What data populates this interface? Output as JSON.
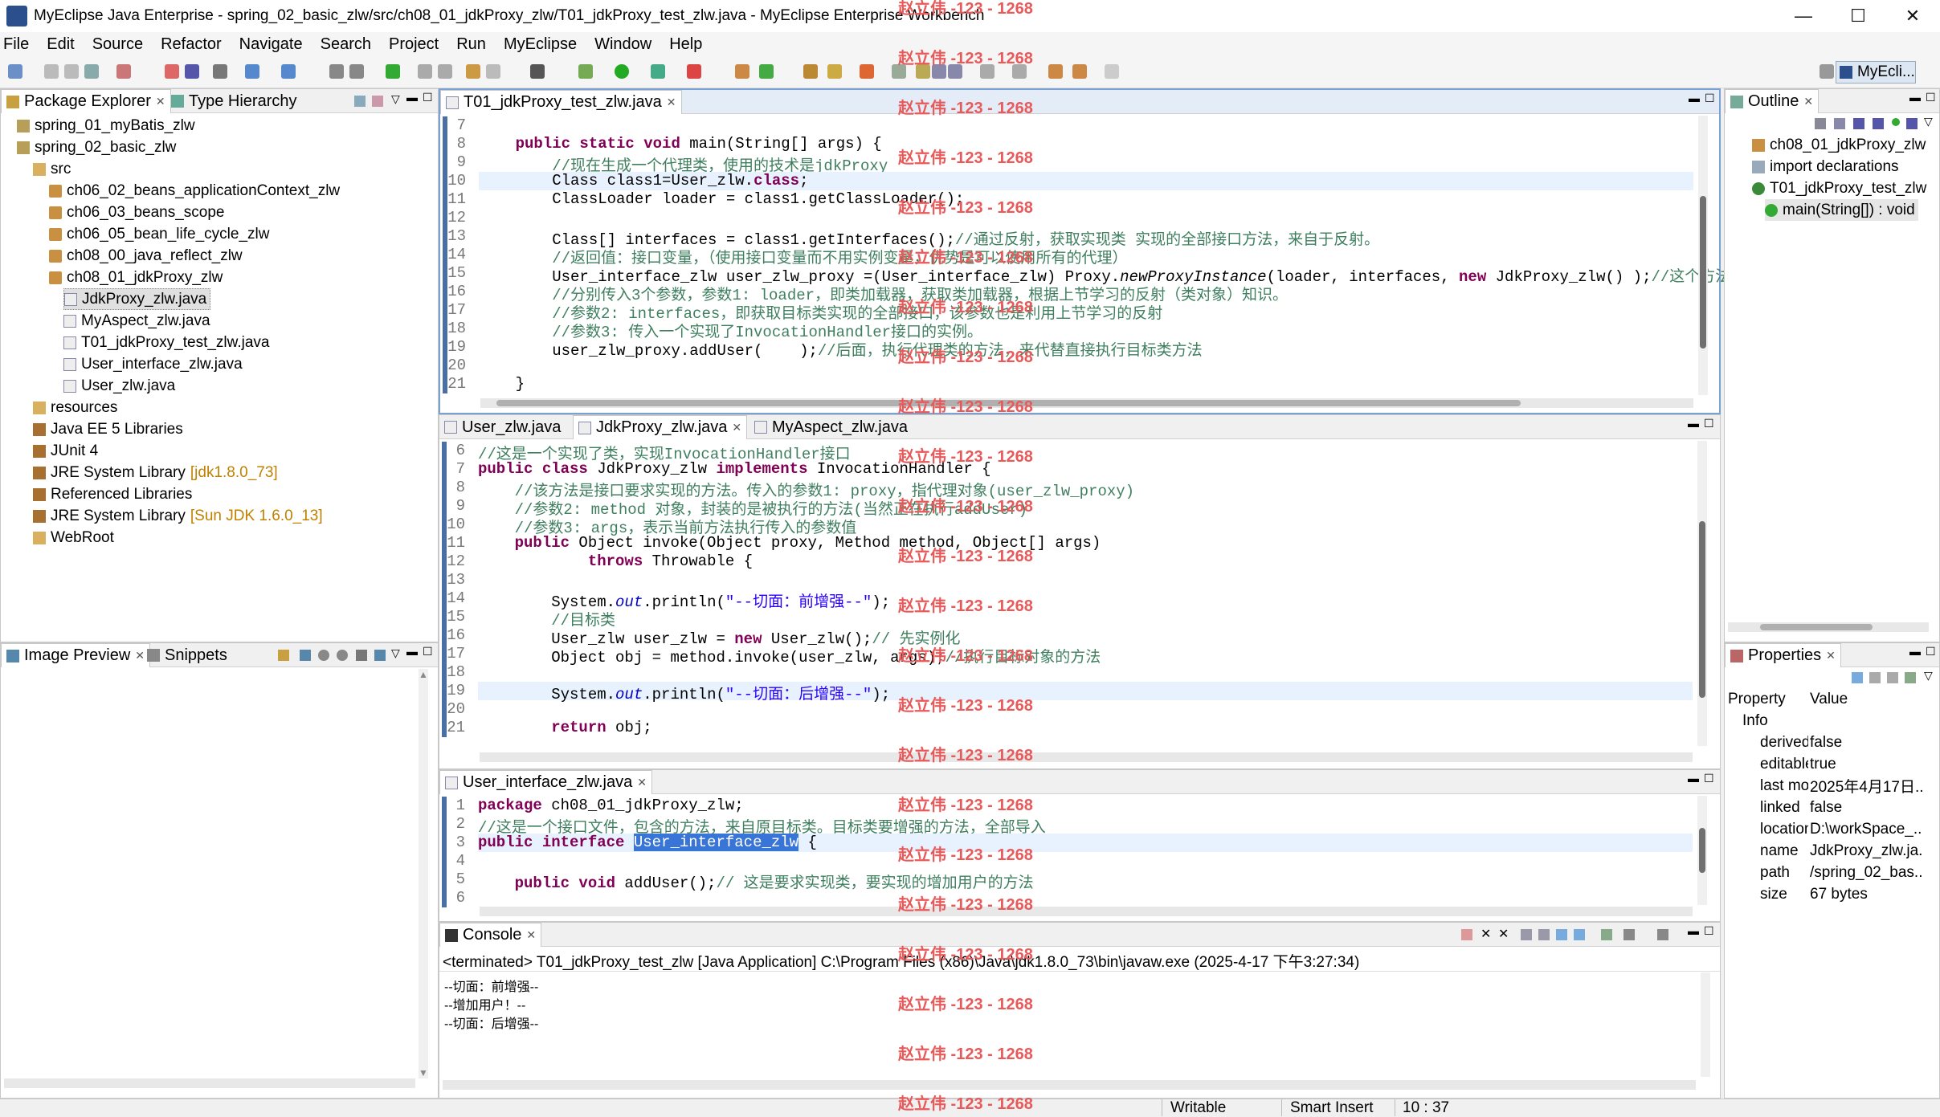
{
  "window": {
    "title": "MyEclipse Java Enterprise - spring_02_basic_zlw/src/ch08_01_jdkProxy_zlw/T01_jdkProxy_test_zlw.java - MyEclipse Enterprise Workbench",
    "minimize": "—",
    "maximize": "☐",
    "close": "✕"
  },
  "menu": [
    "File",
    "Edit",
    "Source",
    "Refactor",
    "Navigate",
    "Search",
    "Project",
    "Run",
    "MyEclipse",
    "Window",
    "Help"
  ],
  "perspective": "MyEcli...",
  "watermark": "赵立伟 -123 - 1268",
  "package_explorer": {
    "tabs": [
      "Package Explorer",
      "Type Hierarchy"
    ],
    "items": [
      {
        "label": "spring_01_myBatis_zlw",
        "decor": ""
      },
      {
        "label": "spring_02_basic_zlw",
        "decor": ""
      },
      {
        "label": "src",
        "decor": ""
      },
      {
        "label": "ch06_02_beans_applicationContext_zlw",
        "decor": ""
      },
      {
        "label": "ch06_03_beans_scope",
        "decor": ""
      },
      {
        "label": "ch06_05_bean_life_cycle_zlw",
        "decor": ""
      },
      {
        "label": "ch08_00_java_reflect_zlw",
        "decor": ""
      },
      {
        "label": "ch08_01_jdkProxy_zlw",
        "decor": ""
      },
      {
        "label": "JdkProxy_zlw.java",
        "decor": ""
      },
      {
        "label": "MyAspect_zlw.java",
        "decor": ""
      },
      {
        "label": "T01_jdkProxy_test_zlw.java",
        "decor": ""
      },
      {
        "label": "User_interface_zlw.java",
        "decor": ""
      },
      {
        "label": "User_zlw.java",
        "decor": ""
      },
      {
        "label": "resources",
        "decor": ""
      },
      {
        "label": "Java EE 5 Libraries",
        "decor": ""
      },
      {
        "label": "JUnit 4",
        "decor": ""
      },
      {
        "label": "JRE System Library",
        "decor": "[jdk1.8.0_73]"
      },
      {
        "label": "Referenced Libraries",
        "decor": ""
      },
      {
        "label": "JRE System Library",
        "decor": "[Sun JDK 1.6.0_13]"
      },
      {
        "label": "WebRoot",
        "decor": ""
      }
    ]
  },
  "image_preview": {
    "tabs": [
      "Image Preview",
      "Snippets"
    ]
  },
  "editor1": {
    "tab": "T01_jdkProxy_test_zlw.java",
    "lines": [
      {
        "n": "7",
        "segs": [
          {
            "t": ""
          }
        ]
      },
      {
        "n": "8",
        "segs": [
          {
            "t": "    "
          },
          {
            "t": "public static",
            "c": "kw"
          },
          {
            "t": " void",
            "c": "kw"
          },
          {
            "t": " main(String[] args) {"
          }
        ]
      },
      {
        "n": "9",
        "segs": [
          {
            "t": "        "
          },
          {
            "t": "//现在生成一个代理类，使用的技术是jdkProxy",
            "c": "cm"
          }
        ]
      },
      {
        "n": "10",
        "segs": [
          {
            "t": "        Class class1=User_zlw."
          },
          {
            "t": "class",
            "c": "kw"
          },
          {
            "t": ";"
          }
        ],
        "hl": true
      },
      {
        "n": "11",
        "segs": [
          {
            "t": "        ClassLoader loader = class1.getClassLoader();"
          }
        ]
      },
      {
        "n": "12",
        "segs": [
          {
            "t": ""
          }
        ]
      },
      {
        "n": "13",
        "segs": [
          {
            "t": "        Class[] interfaces = class1.getInterfaces();"
          },
          {
            "t": "//通过反射，获取实现类 实现的全部接口方法，来自于反射。",
            "c": "cm"
          }
        ]
      },
      {
        "n": "14",
        "segs": [
          {
            "t": "        "
          },
          {
            "t": "//返回值：接口变量，（使用接口变量而不用实例变量，优势是可以使用所有的代理）",
            "c": "cm"
          }
        ]
      },
      {
        "n": "15",
        "segs": [
          {
            "t": "        User_interface_zlw user_zlw_proxy =(User_interface_zlw) Proxy."
          },
          {
            "t": "newProxyInstance",
            "c": "ita"
          },
          {
            "t": "(loader, interfaces, "
          },
          {
            "t": "new",
            "c": "kw"
          },
          {
            "t": " JdkProxy_zlw() );"
          },
          {
            "t": "//这个方法是",
            "c": "cm"
          }
        ]
      },
      {
        "n": "16",
        "segs": [
          {
            "t": "        "
          },
          {
            "t": "//分别传入3个参数，参数1: loader，即类加载器，获取类加载器，根据上节学习的反射（类对象）知识。",
            "c": "cm"
          }
        ]
      },
      {
        "n": "17",
        "segs": [
          {
            "t": "        "
          },
          {
            "t": "//参数2: interfaces，即获取目标类实现的全部接口，该参数也是利用上节学习的反射",
            "c": "cm"
          }
        ]
      },
      {
        "n": "18",
        "segs": [
          {
            "t": "        "
          },
          {
            "t": "//参数3: 传入一个实现了InvocationHandler接口的实例。",
            "c": "cm"
          }
        ]
      },
      {
        "n": "19",
        "segs": [
          {
            "t": "        user_zlw_proxy.addUser(    );"
          },
          {
            "t": "//后面，执行代理类的方法，来代替直接执行目标类方法",
            "c": "cm"
          }
        ]
      },
      {
        "n": "20",
        "segs": [
          {
            "t": ""
          }
        ]
      },
      {
        "n": "21",
        "segs": [
          {
            "t": "    }"
          }
        ]
      }
    ]
  },
  "editor2": {
    "tabs": [
      "User_zlw.java",
      "JdkProxy_zlw.java",
      "MyAspect_zlw.java"
    ],
    "lines": [
      {
        "n": "6",
        "segs": [
          {
            "t": "//这是一个实现了类，实现InvocationHandler接口",
            "c": "cm"
          }
        ]
      },
      {
        "n": "7",
        "segs": [
          {
            "t": "public class",
            "c": "kw"
          },
          {
            "t": " JdkProxy_zlw "
          },
          {
            "t": "implements",
            "c": "kw"
          },
          {
            "t": " InvocationHandler {"
          }
        ]
      },
      {
        "n": "8",
        "segs": [
          {
            "t": "    "
          },
          {
            "t": "//该方法是接口要求实现的方法。传入的参数1: proxy，指代理对象(user_zlw_proxy)",
            "c": "cm"
          }
        ]
      },
      {
        "n": "9",
        "segs": [
          {
            "t": "    "
          },
          {
            "t": "//参数2: method 对象，封装的是被执行的方法(当然正在执行addUser)",
            "c": "cm"
          }
        ]
      },
      {
        "n": "10",
        "segs": [
          {
            "t": "    "
          },
          {
            "t": "//参数3: args，表示当前方法执行传入的参数值",
            "c": "cm"
          }
        ]
      },
      {
        "n": "11",
        "segs": [
          {
            "t": "    "
          },
          {
            "t": "public",
            "c": "kw"
          },
          {
            "t": " Object invoke(Object proxy, Method method, Object[] args)"
          }
        ]
      },
      {
        "n": "12",
        "segs": [
          {
            "t": "            "
          },
          {
            "t": "throws",
            "c": "kw"
          },
          {
            "t": " Throwable {"
          }
        ]
      },
      {
        "n": "13",
        "segs": [
          {
            "t": ""
          }
        ]
      },
      {
        "n": "14",
        "segs": [
          {
            "t": "        System."
          },
          {
            "t": "out",
            "c": "fi"
          },
          {
            "t": ".println("
          },
          {
            "t": "\"--切面：前增强--\"",
            "c": "st"
          },
          {
            "t": ");"
          }
        ]
      },
      {
        "n": "15",
        "segs": [
          {
            "t": "        "
          },
          {
            "t": "//目标类",
            "c": "cm"
          }
        ]
      },
      {
        "n": "16",
        "segs": [
          {
            "t": "        User_zlw user_zlw = "
          },
          {
            "t": "new",
            "c": "kw"
          },
          {
            "t": " User_zlw();"
          },
          {
            "t": "// 先实例化",
            "c": "cm"
          }
        ]
      },
      {
        "n": "17",
        "segs": [
          {
            "t": "        Object obj = method.invoke(user_zlw, args);"
          },
          {
            "t": "//执行目标对象的方法",
            "c": "cm"
          }
        ]
      },
      {
        "n": "18",
        "segs": [
          {
            "t": ""
          }
        ]
      },
      {
        "n": "19",
        "segs": [
          {
            "t": "        System."
          },
          {
            "t": "out",
            "c": "fi"
          },
          {
            "t": ".println("
          },
          {
            "t": "\"--切面：后增强--\"",
            "c": "st"
          },
          {
            "t": ");"
          }
        ],
        "hl": true
      },
      {
        "n": "20",
        "segs": [
          {
            "t": ""
          }
        ]
      },
      {
        "n": "21",
        "segs": [
          {
            "t": "        "
          },
          {
            "t": "return",
            "c": "kw"
          },
          {
            "t": " obj;"
          }
        ]
      }
    ]
  },
  "editor3": {
    "tab": "User_interface_zlw.java",
    "lines": [
      {
        "n": "1",
        "segs": [
          {
            "t": "package",
            "c": "kw"
          },
          {
            "t": " ch08_01_jdkProxy_zlw;"
          }
        ]
      },
      {
        "n": "2",
        "segs": [
          {
            "t": "//这是一个接口文件，包含的方法，来自原目标类。目标类要增强的方法，全部导入",
            "c": "cm"
          }
        ]
      },
      {
        "n": "3",
        "segs": [
          {
            "t": "public interface",
            "c": "kw"
          },
          {
            "t": " "
          },
          {
            "t": "User_interface_zlw",
            "c": "sel"
          },
          {
            "t": " {"
          }
        ],
        "hl": true
      },
      {
        "n": "4",
        "segs": [
          {
            "t": ""
          }
        ]
      },
      {
        "n": "5",
        "segs": [
          {
            "t": "    "
          },
          {
            "t": "public void",
            "c": "kw"
          },
          {
            "t": " addUser();"
          },
          {
            "t": "// 这是要求实现类，要实现的增加用户的方法",
            "c": "cm"
          }
        ]
      },
      {
        "n": "6",
        "segs": [
          {
            "t": ""
          }
        ]
      }
    ]
  },
  "console": {
    "tab": "Console",
    "header": "<terminated> T01_jdkProxy_test_zlw [Java Application] C:\\Program Files (x86)\\Java\\jdk1.8.0_73\\bin\\javaw.exe (2025-4-17 下午3:27:34)",
    "lines": [
      "--切面：前增强--",
      "--增加用户！--",
      "--切面：后增强--"
    ]
  },
  "outline": {
    "tab": "Outline",
    "items": [
      "ch08_01_jdkProxy_zlw",
      "import declarations",
      "T01_jdkProxy_test_zlw",
      "main(String[]) : void"
    ]
  },
  "properties": {
    "tab": "Properties",
    "col_property": "Property",
    "col_value": "Value",
    "group": "Info",
    "rows": [
      {
        "k": "derived",
        "v": "false"
      },
      {
        "k": "editable",
        "v": "true"
      },
      {
        "k": "last modified",
        "v": "2025年4月17日..."
      },
      {
        "k": "linked",
        "v": "false"
      },
      {
        "k": "location",
        "v": "D:\\workSpace_..."
      },
      {
        "k": "name",
        "v": "JdkProxy_zlw.ja..."
      },
      {
        "k": "path",
        "v": "/spring_02_bas..."
      },
      {
        "k": "size",
        "v": "67  bytes"
      }
    ]
  },
  "status": {
    "writable": "Writable",
    "insert": "Smart Insert",
    "position": "10 : 37"
  },
  "colors": {
    "keyword": "#7f0055",
    "comment": "#3f7f5f",
    "string": "#2a00ff",
    "watermark": "#e85a5a",
    "selection": "#3875d7"
  }
}
